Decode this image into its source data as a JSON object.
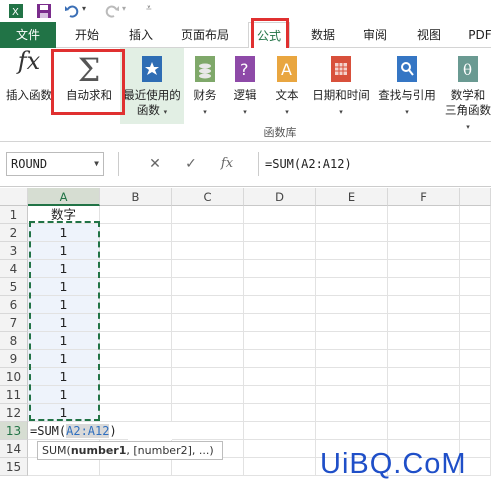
{
  "tabs": {
    "file": "文件",
    "home": "开始",
    "insert": "插入",
    "page_layout": "页面布局",
    "formulas": "公式",
    "data": "数据",
    "review": "审阅",
    "view": "视图",
    "pdf": "PDF"
  },
  "ribbon": {
    "insert_function": "插入函数",
    "autosum": "自动求和",
    "recent_line1": "最近使用的",
    "recent_line2": "函数",
    "financial": "财务",
    "logical": "逻辑",
    "text": "文本",
    "datetime": "日期和时间",
    "lookup": "查找与引用",
    "math_line1": "数学和",
    "math_line2": "三角函数",
    "group_label": "函数库",
    "dropdown_arrow": "▾"
  },
  "formula_bar": {
    "name_box": "ROUND",
    "cancel": "✕",
    "enter": "✓",
    "fx": "fx",
    "formula": "=SUM(A2:A12)"
  },
  "columns": [
    "A",
    "B",
    "C",
    "D",
    "E",
    "F"
  ],
  "rows": [
    "1",
    "2",
    "3",
    "4",
    "5",
    "6",
    "7",
    "8",
    "9",
    "10",
    "11",
    "12",
    "13",
    "14",
    "15"
  ],
  "cells": {
    "a1": "数字",
    "values": [
      "1",
      "1",
      "1",
      "1",
      "1",
      "1",
      "1",
      "1",
      "1",
      "1",
      "1"
    ],
    "a13_prefix": "=SUM(",
    "a13_ref": "A2:A12",
    "a13_suffix": ")"
  },
  "tooltip": {
    "fn": "SUM(",
    "arg1": "number1",
    "rest": ", [number2], ...)"
  },
  "watermark": "UiBQ.CoM",
  "colors": {
    "excel_green": "#217346",
    "highlight_red": "#e03030",
    "watermark_blue": "#1f4fc8"
  }
}
